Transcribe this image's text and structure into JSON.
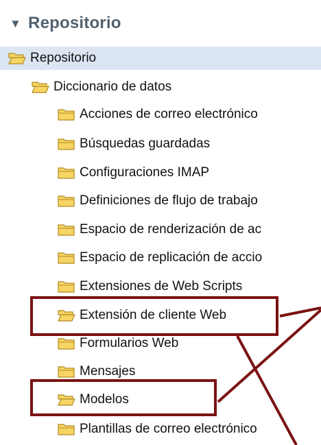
{
  "header": {
    "toggle": "▼",
    "title": "Repositorio"
  },
  "tree": {
    "root": {
      "label": "Repositorio",
      "icon": "folder-open-icon"
    },
    "dictionary": {
      "label": "Diccionario de datos",
      "icon": "folder-open-icon"
    },
    "items": [
      {
        "label": "Acciones de correo electrónico",
        "icon": "folder-closed-icon"
      },
      {
        "label": "Búsquedas guardadas",
        "icon": "folder-closed-icon"
      },
      {
        "label": "Configuraciones IMAP",
        "icon": "folder-closed-icon"
      },
      {
        "label": "Definiciones de flujo de trabajo",
        "icon": "folder-closed-icon"
      },
      {
        "label": "Espacio de renderización de ac",
        "icon": "folder-closed-icon"
      },
      {
        "label": "Espacio de replicación de accio",
        "icon": "folder-closed-icon"
      },
      {
        "label": "Extensiones de Web Scripts",
        "icon": "folder-closed-icon"
      },
      {
        "label": "Extensión de cliente Web",
        "icon": "folder-open-icon"
      },
      {
        "label": "Formularios Web",
        "icon": "folder-closed-icon"
      },
      {
        "label": "Mensajes",
        "icon": "folder-closed-icon"
      },
      {
        "label": "Modelos",
        "icon": "folder-open-icon"
      },
      {
        "label": "Plantillas de correo electrónico",
        "icon": "folder-closed-icon"
      }
    ]
  },
  "colors": {
    "header_text": "#51626f",
    "selected_bg": "#dce6f2",
    "annotation": "#7a1212",
    "folder_fill": "#f7d564",
    "folder_stroke": "#b08a20"
  }
}
